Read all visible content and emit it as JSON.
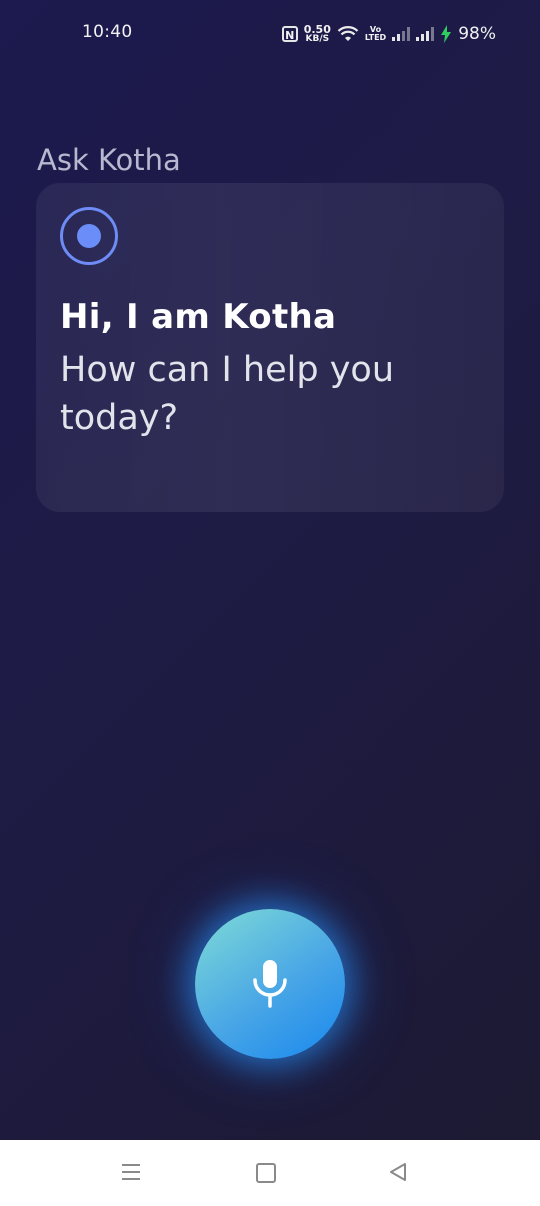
{
  "status_bar": {
    "time": "10:40",
    "nfc_label": "N",
    "net_speed_value": "0.50",
    "net_speed_unit": "KB/S",
    "volte_top": "Vo",
    "volte_bottom": "LTED",
    "battery": "98%",
    "icons": [
      "nfc-icon",
      "wifi-icon",
      "volte-icon",
      "signal-icon",
      "signal-icon",
      "charging-bolt-icon"
    ]
  },
  "assistant": {
    "title": "Ask Kotha",
    "greeting": "Hi, I am Kotha",
    "prompt": "How can I help you today?",
    "mic_icon": "microphone-icon"
  },
  "nav_bar": {
    "icons": [
      "menu-icon",
      "home-icon",
      "back-icon"
    ]
  },
  "colors": {
    "background": "#1d1a45",
    "accent": "#6b8df8",
    "mic_gradient_start": "#7fdcd6",
    "mic_gradient_end": "#1787ee"
  }
}
